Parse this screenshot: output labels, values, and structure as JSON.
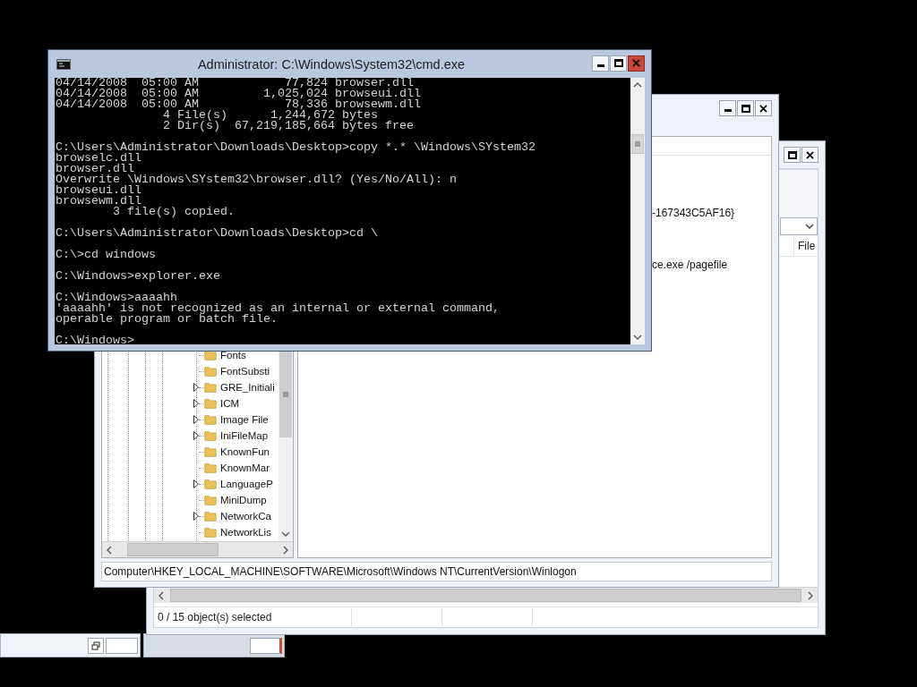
{
  "cmd_window": {
    "title": "Administrator: C:\\Windows\\System32\\cmd.exe",
    "console_blocks": [
      [
        "04/14/2008  05:00 AM            77,824 browser.dll",
        "04/14/2008  05:00 AM         1,025,024 browseui.dll",
        "04/14/2008  05:00 AM            78,336 browsewm.dll",
        "               4 File(s)      1,244,672 bytes",
        "               2 Dir(s)  67,219,185,664 bytes free"
      ],
      [
        "C:\\Users\\Administrator\\Downloads\\Desktop>copy *.* \\Windows\\SYstem32",
        "browselc.dll",
        "browser.dll",
        "Overwrite \\Windows\\SYstem32\\browser.dll? (Yes/No/All): n",
        "browseui.dll",
        "browsewm.dll",
        "        3 file(s) copied."
      ],
      [
        "C:\\Users\\Administrator\\Downloads\\Desktop>cd \\"
      ],
      [
        "C:\\>cd windows"
      ],
      [
        "C:\\Windows>explorer.exe"
      ],
      [
        "C:\\Windows>aaaahh",
        "'aaaahh' is not recognized as an internal or external command,",
        "operable program or batch file."
      ],
      [
        "C:\\Windows>"
      ]
    ]
  },
  "registry_window": {
    "tree_items": [
      {
        "label": "Fonts",
        "has_children": false
      },
      {
        "label": "FontSubsti",
        "has_children": false
      },
      {
        "label": "GRE_Initiali",
        "has_children": true
      },
      {
        "label": "ICM",
        "has_children": true
      },
      {
        "label": "Image File",
        "has_children": true
      },
      {
        "label": "IniFileMap",
        "has_children": true
      },
      {
        "label": "KnownFun",
        "has_children": false
      },
      {
        "label": "KnownMar",
        "has_children": false
      },
      {
        "label": "LanguageP",
        "has_children": true
      },
      {
        "label": "MiniDump",
        "has_children": false
      },
      {
        "label": "NetworkCa",
        "has_children": true
      },
      {
        "label": "NetworkLis",
        "has_children": false
      }
    ],
    "value_data": [
      "-167343C5AF16}",
      "ce.exe /pagefile"
    ],
    "key_path": "Computer\\HKEY_LOCAL_MACHINE\\SOFTWARE\\Microsoft\\Windows NT\\CurrentVersion\\Winlogon"
  },
  "back_window": {
    "column_header": "File",
    "status": "0 / 15 object(s) selected"
  }
}
